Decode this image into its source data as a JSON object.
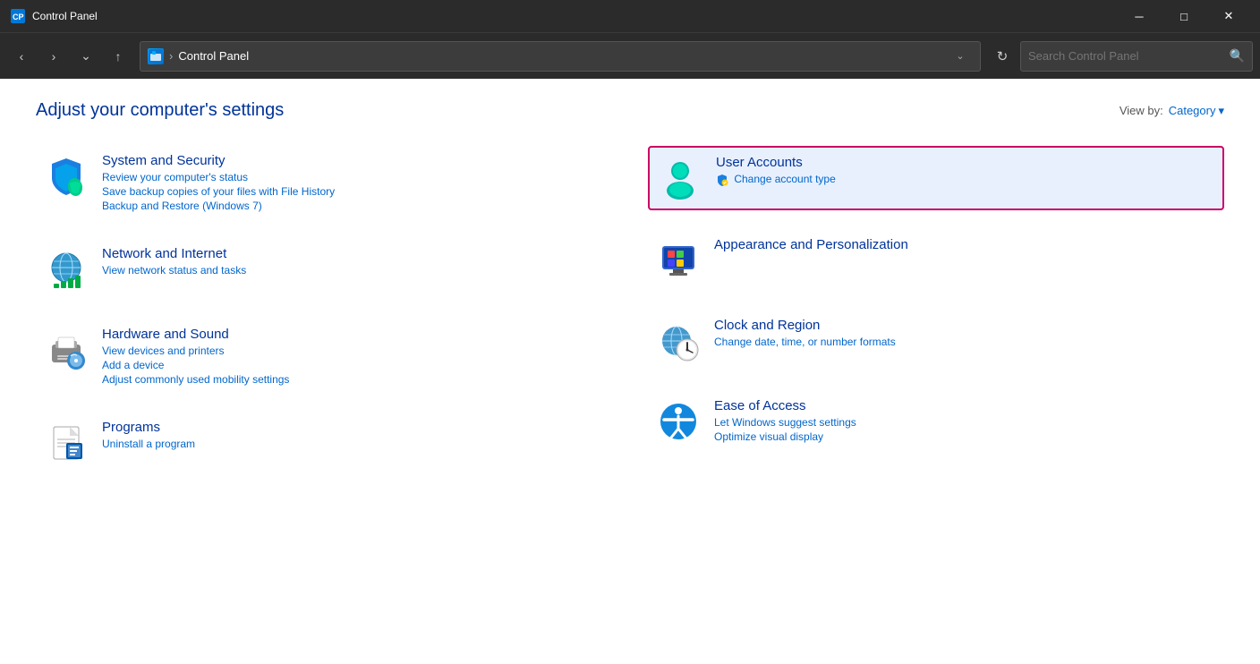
{
  "window": {
    "title": "Control Panel",
    "icon": "CP"
  },
  "titlebar": {
    "minimize": "─",
    "maximize": "□",
    "close": "✕"
  },
  "navbar": {
    "back": "‹",
    "forward": "›",
    "dropdown": "⌄",
    "up": "↑",
    "address_icon": "CP",
    "separator": "›",
    "address": "Control Panel",
    "refresh": "↻"
  },
  "search": {
    "placeholder": "Search Control Panel",
    "icon": "🔍"
  },
  "main": {
    "title": "Adjust your computer's settings",
    "viewby_label": "View by:",
    "viewby_value": "Category",
    "viewby_arrow": "▾"
  },
  "categories_left": [
    {
      "id": "system-security",
      "name": "System and Security",
      "links": [
        "Review your computer's status",
        "Save backup copies of your files with File History",
        "Backup and Restore (Windows 7)"
      ]
    },
    {
      "id": "network-internet",
      "name": "Network and Internet",
      "links": [
        "View network status and tasks"
      ]
    },
    {
      "id": "hardware-sound",
      "name": "Hardware and Sound",
      "links": [
        "View devices and printers",
        "Add a device",
        "Adjust commonly used mobility settings"
      ]
    },
    {
      "id": "programs",
      "name": "Programs",
      "links": [
        "Uninstall a program"
      ]
    }
  ],
  "categories_right": [
    {
      "id": "user-accounts",
      "name": "User Accounts",
      "links": [
        "Change account type"
      ],
      "highlighted": true
    },
    {
      "id": "appearance-personalization",
      "name": "Appearance and Personalization",
      "links": []
    },
    {
      "id": "clock-region",
      "name": "Clock and Region",
      "links": [
        "Change date, time, or number formats"
      ]
    },
    {
      "id": "ease-access",
      "name": "Ease of Access",
      "links": [
        "Let Windows suggest settings",
        "Optimize visual display"
      ]
    }
  ]
}
